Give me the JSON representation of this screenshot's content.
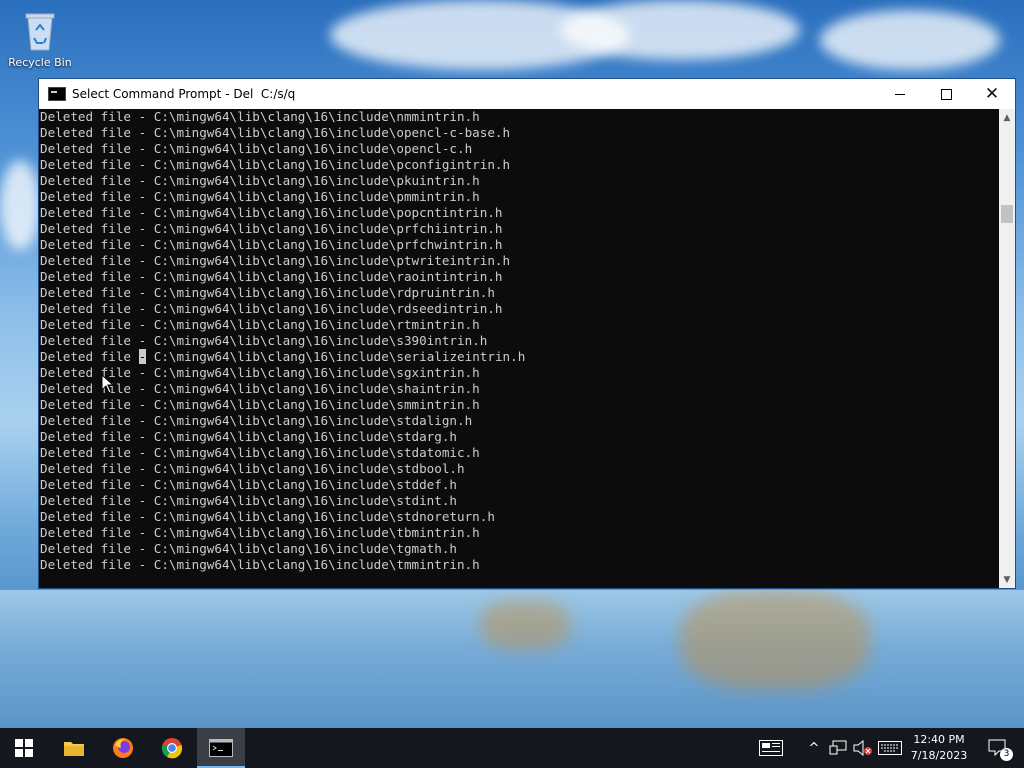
{
  "desktop": {
    "icons": [
      {
        "label": "Recycle Bin",
        "icon": "recycle-bin-icon"
      }
    ]
  },
  "window": {
    "title": "Select Command Prompt - Del  C:/s/q",
    "icon": "command-prompt-icon",
    "controls": {
      "minimize": "minimize-icon",
      "maximize": "maximize-icon",
      "close": "close-icon"
    }
  },
  "console": {
    "selected_char_line": 15,
    "lines": [
      "Deleted file - C:\\mingw64\\lib\\clang\\16\\include\\nmmintrin.h",
      "Deleted file - C:\\mingw64\\lib\\clang\\16\\include\\opencl-c-base.h",
      "Deleted file - C:\\mingw64\\lib\\clang\\16\\include\\opencl-c.h",
      "Deleted file - C:\\mingw64\\lib\\clang\\16\\include\\pconfigintrin.h",
      "Deleted file - C:\\mingw64\\lib\\clang\\16\\include\\pkuintrin.h",
      "Deleted file - C:\\mingw64\\lib\\clang\\16\\include\\pmmintrin.h",
      "Deleted file - C:\\mingw64\\lib\\clang\\16\\include\\popcntintrin.h",
      "Deleted file - C:\\mingw64\\lib\\clang\\16\\include\\prfchiintrin.h",
      "Deleted file - C:\\mingw64\\lib\\clang\\16\\include\\prfchwintrin.h",
      "Deleted file - C:\\mingw64\\lib\\clang\\16\\include\\ptwriteintrin.h",
      "Deleted file - C:\\mingw64\\lib\\clang\\16\\include\\raointintrin.h",
      "Deleted file - C:\\mingw64\\lib\\clang\\16\\include\\rdpruintrin.h",
      "Deleted file - C:\\mingw64\\lib\\clang\\16\\include\\rdseedintrin.h",
      "Deleted file - C:\\mingw64\\lib\\clang\\16\\include\\rtmintrin.h",
      "Deleted file - C:\\mingw64\\lib\\clang\\16\\include\\s390intrin.h",
      "Deleted file - C:\\mingw64\\lib\\clang\\16\\include\\serializeintrin.h",
      "Deleted file - C:\\mingw64\\lib\\clang\\16\\include\\sgxintrin.h",
      "Deleted file - C:\\mingw64\\lib\\clang\\16\\include\\shaintrin.h",
      "Deleted file - C:\\mingw64\\lib\\clang\\16\\include\\smmintrin.h",
      "Deleted file - C:\\mingw64\\lib\\clang\\16\\include\\stdalign.h",
      "Deleted file - C:\\mingw64\\lib\\clang\\16\\include\\stdarg.h",
      "Deleted file - C:\\mingw64\\lib\\clang\\16\\include\\stdatomic.h",
      "Deleted file - C:\\mingw64\\lib\\clang\\16\\include\\stdbool.h",
      "Deleted file - C:\\mingw64\\lib\\clang\\16\\include\\stddef.h",
      "Deleted file - C:\\mingw64\\lib\\clang\\16\\include\\stdint.h",
      "Deleted file - C:\\mingw64\\lib\\clang\\16\\include\\stdnoreturn.h",
      "Deleted file - C:\\mingw64\\lib\\clang\\16\\include\\tbmintrin.h",
      "Deleted file - C:\\mingw64\\lib\\clang\\16\\include\\tgmath.h",
      "Deleted file - C:\\mingw64\\lib\\clang\\16\\include\\tmmintrin.h"
    ]
  },
  "taskbar": {
    "pinned": [
      {
        "name": "start-button",
        "icon": "windows-logo-icon"
      },
      {
        "name": "file-explorer",
        "icon": "folder-icon"
      },
      {
        "name": "firefox",
        "icon": "firefox-icon"
      },
      {
        "name": "chrome",
        "icon": "chrome-icon"
      },
      {
        "name": "command-prompt",
        "icon": "command-prompt-icon",
        "active": true
      }
    ],
    "tray_icons": [
      "news-icon",
      "chevron-up-icon",
      "network-icon",
      "volume-muted-icon",
      "keyboard-icon"
    ],
    "clock": {
      "time": "12:40 PM",
      "date": "7/18/2023"
    },
    "notifications": {
      "icon": "notification-icon",
      "count": "3"
    }
  }
}
